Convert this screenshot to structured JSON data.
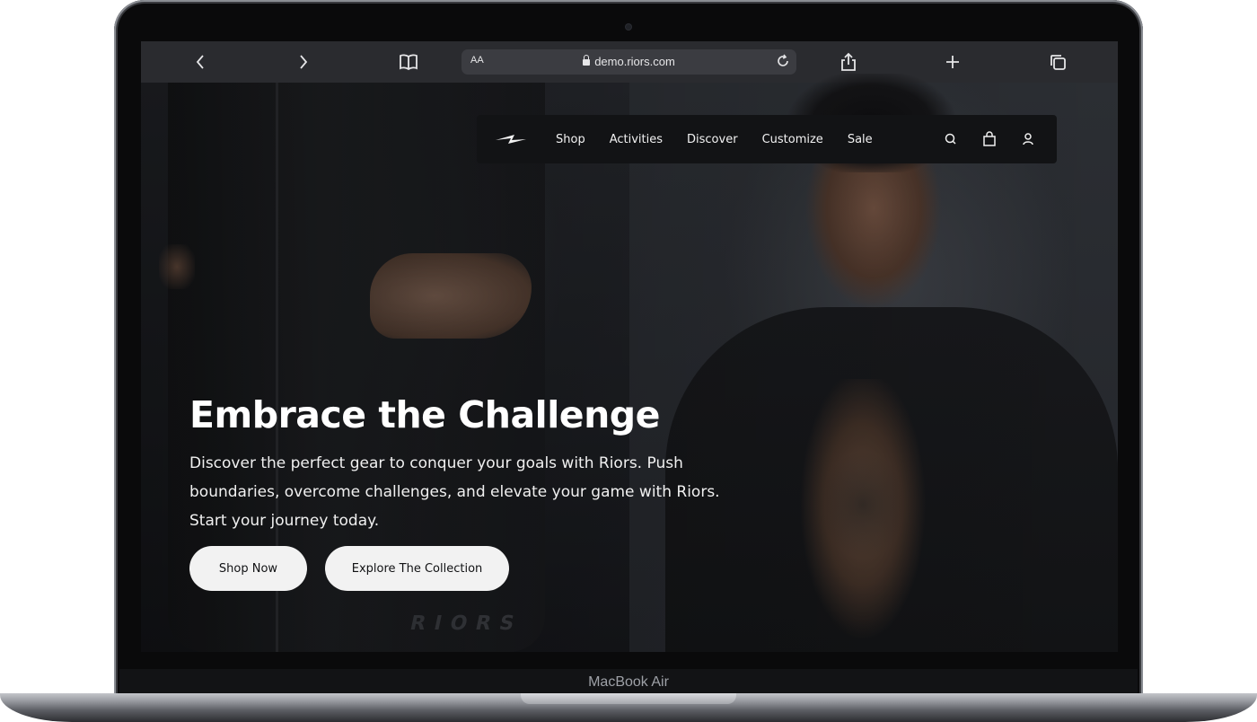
{
  "device": {
    "label": "MacBook Air"
  },
  "browser": {
    "text_size_label": "AA",
    "url": "demo.riors.com",
    "icons": [
      "chevron-left-icon",
      "chevron-right-icon",
      "book-icon",
      "lock-icon",
      "reload-icon",
      "share-icon",
      "plus-icon",
      "tabs-icon"
    ]
  },
  "nav": {
    "brand_icon": "bolt-logo-icon",
    "items": [
      "Shop",
      "Activities",
      "Discover",
      "Customize",
      "Sale"
    ],
    "icons": [
      "search-icon",
      "bag-icon",
      "user-icon"
    ]
  },
  "hero": {
    "headline": "Embrace the Challenge",
    "description": "Discover the perfect gear to conquer your goals with Riors. Push boundaries, overcome challenges, and elevate your game with Riors. Start your journey today.",
    "primary_button": "Shop Now",
    "secondary_button": "Explore The Collection"
  },
  "colors": {
    "toolbar_bg": "#2a2b2f",
    "nav_bg": "#121315",
    "button_bg": "#f2f2f2",
    "text": "#ffffff"
  }
}
